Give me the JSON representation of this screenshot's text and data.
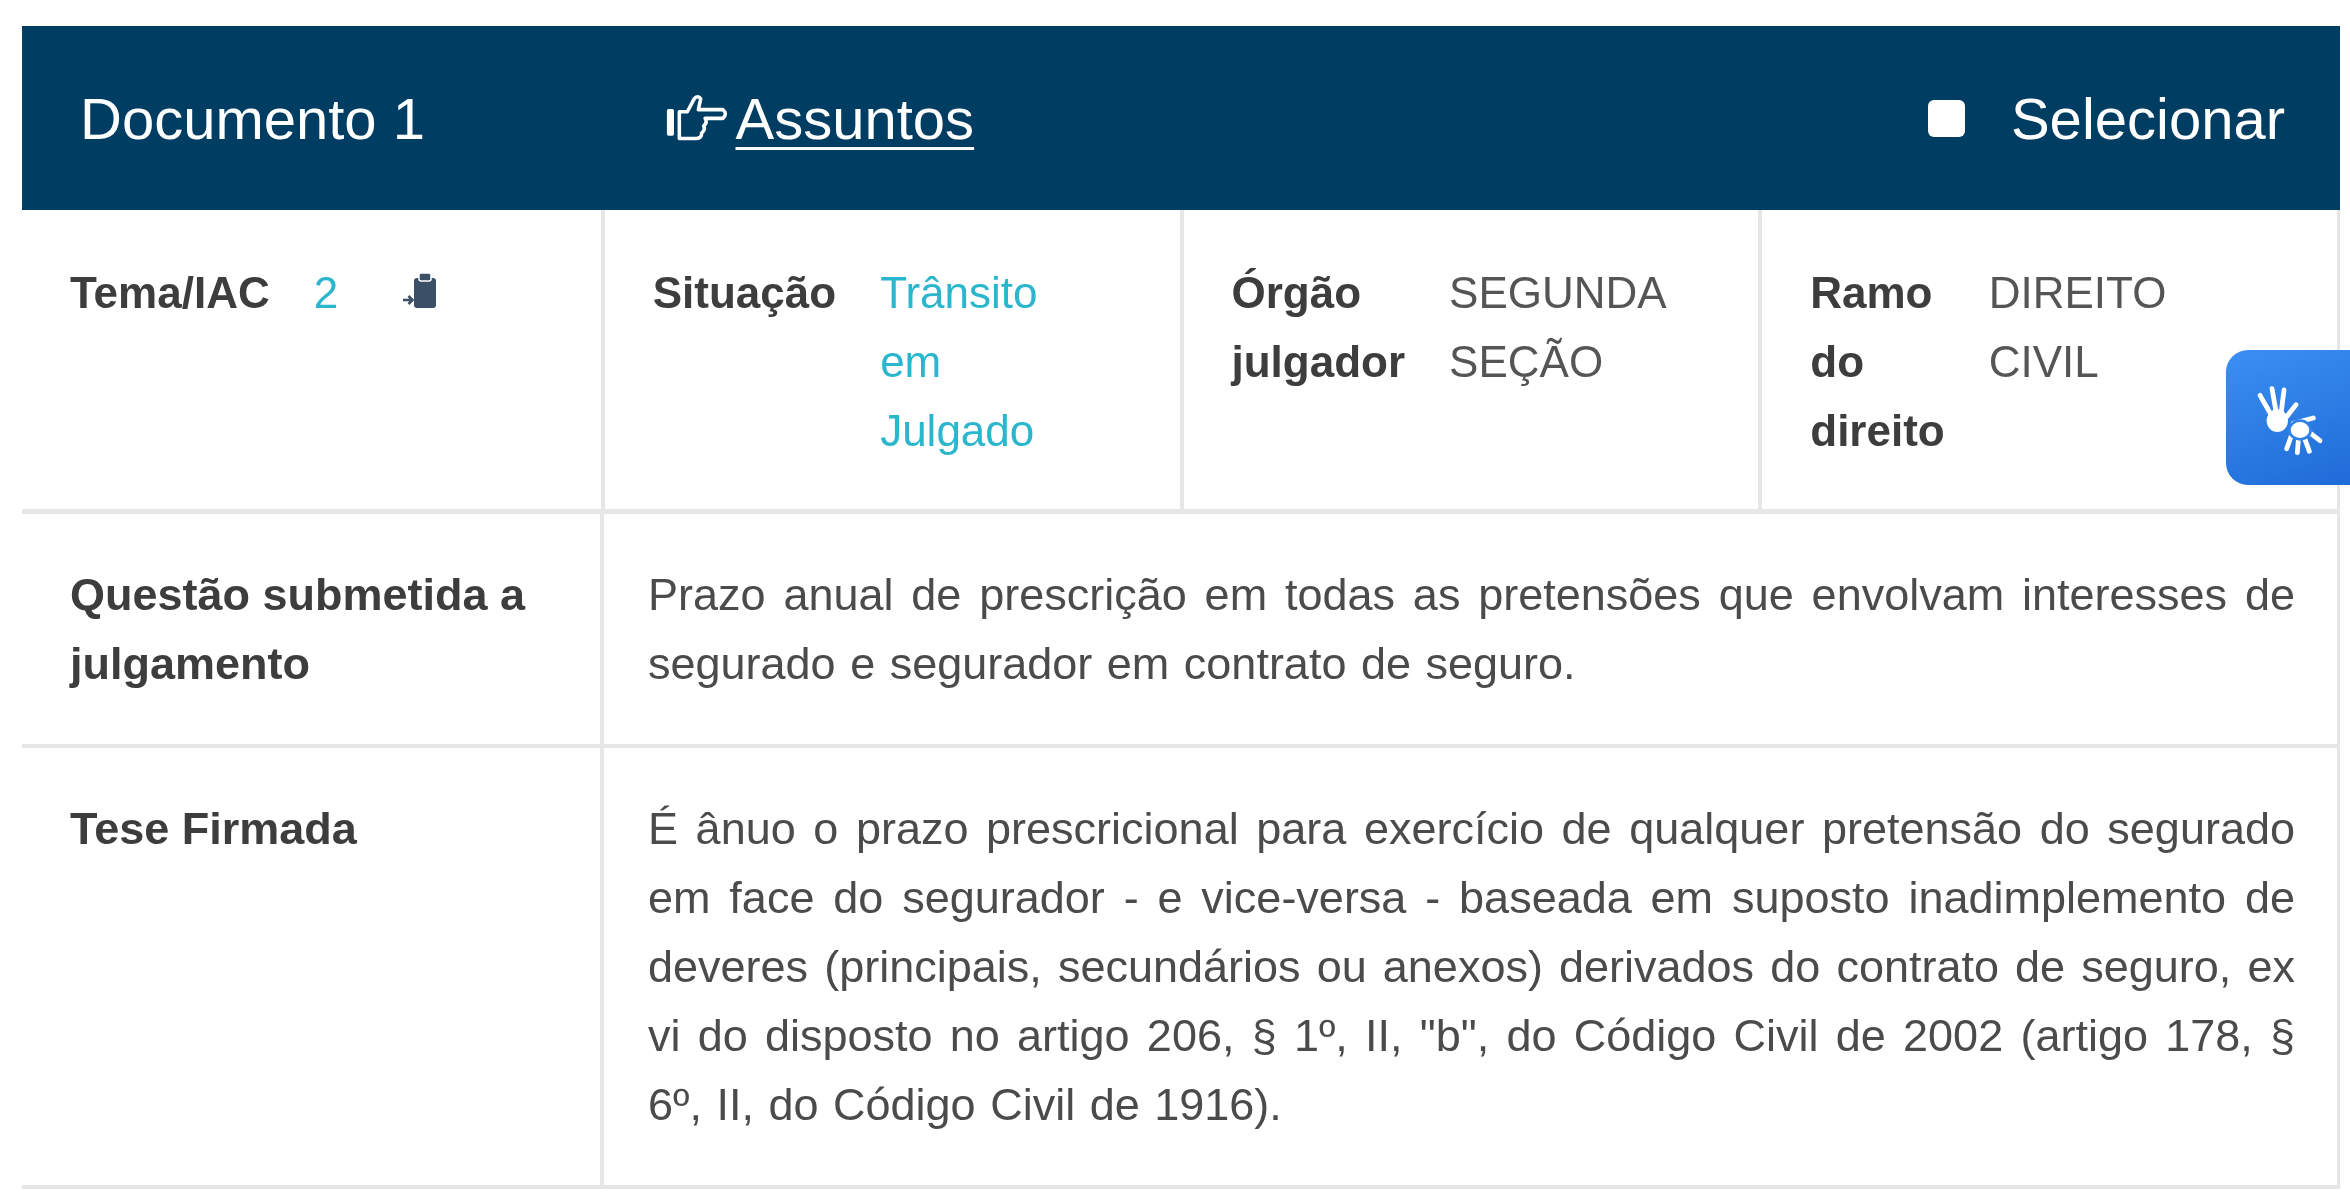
{
  "header": {
    "title": "Documento 1",
    "link": {
      "label": "Assuntos"
    },
    "select": {
      "label": "Selecionar",
      "checked": false
    }
  },
  "meta": [
    {
      "kind": "link",
      "label": "Tema/IAC",
      "value": "2"
    },
    {
      "kind": "status",
      "label": "Situação",
      "value": "Trânsito em Julgado"
    },
    {
      "kind": "plain",
      "label": "Órgão julgador",
      "value": "SEGUNDA SEÇÃO"
    },
    {
      "kind": "plain",
      "label": "Ramo do direito",
      "value": "DIREITO CIVIL"
    }
  ],
  "rows": [
    {
      "label": "Questão submetida a julgamento",
      "text": "Prazo anual de prescrição em todas as pretensões que envolvam interesses de segurado e segurador em contrato de seguro."
    },
    {
      "label": "Tese Firmada",
      "text": "É ânuo o prazo prescricional para exercício de qualquer pretensão do segurado em face do segurador - e vice-versa - baseada em suposto inadimplemento de deveres (principais, secundários ou anexos) derivados do contrato de seguro, ex vi do disposto no artigo 206, § 1º, II, \"b\", do Código Civil de 2002 (artigo 178, § 6º, II, do Código Civil de 1916)."
    }
  ]
}
